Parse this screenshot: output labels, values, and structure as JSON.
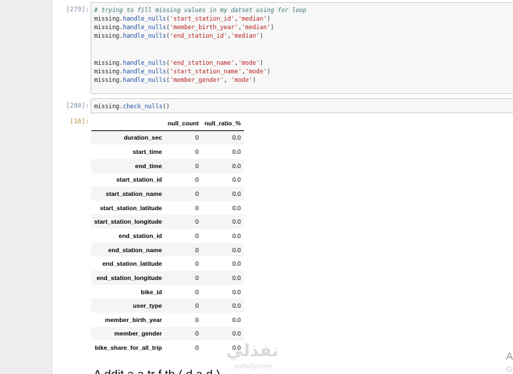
{
  "cells": {
    "loop_cell": {
      "prompt": "[279]:",
      "comment": "# trying to fill missing values in my datset using for loop",
      "lines": [
        {
          "obj": "missing",
          "fn": "handle_nulls",
          "arg1": "'start_station_id'",
          "arg2": "'median'"
        },
        {
          "obj": "missing",
          "fn": "handle_nulls",
          "arg1": "'member_birth_year'",
          "arg2": "'median'"
        },
        {
          "obj": "missing",
          "fn": "handle_nulls",
          "arg1": "'end_station_id'",
          "arg2": "'median'"
        },
        {
          "obj": "missing",
          "fn": "handle_nulls",
          "arg1": "'end_station_name'",
          "arg2": "'mode'"
        },
        {
          "obj": "missing",
          "fn": "handle_nulls",
          "arg1": "'start_station_name'",
          "arg2": "'mode'"
        },
        {
          "obj": "missing",
          "fn": "handle_nulls",
          "arg1": "'member_gender'",
          "arg2": " 'mode'"
        }
      ]
    },
    "check_cell": {
      "prompt": "[280]:",
      "obj": "missing",
      "fn": "check_nulls",
      "call_suffix": "()"
    },
    "output": {
      "prompt": "[16]:",
      "columns": [
        "null_count",
        "null_ratio_%"
      ],
      "rows": [
        {
          "index": "duration_sec",
          "null_count": "0",
          "null_ratio": "0.0"
        },
        {
          "index": "start_time",
          "null_count": "0",
          "null_ratio": "0.0"
        },
        {
          "index": "end_time",
          "null_count": "0",
          "null_ratio": "0.0"
        },
        {
          "index": "start_station_id",
          "null_count": "0",
          "null_ratio": "0.0"
        },
        {
          "index": "start_station_name",
          "null_count": "0",
          "null_ratio": "0.0"
        },
        {
          "index": "start_station_latitude",
          "null_count": "0",
          "null_ratio": "0.0"
        },
        {
          "index": "start_station_longitude",
          "null_count": "0",
          "null_ratio": "0.0"
        },
        {
          "index": "end_station_id",
          "null_count": "0",
          "null_ratio": "0.0"
        },
        {
          "index": "end_station_name",
          "null_count": "0",
          "null_ratio": "0.0"
        },
        {
          "index": "end_station_latitude",
          "null_count": "0",
          "null_ratio": "0.0"
        },
        {
          "index": "end_station_longitude",
          "null_count": "0",
          "null_ratio": "0.0"
        },
        {
          "index": "bike_id",
          "null_count": "0",
          "null_ratio": "0.0"
        },
        {
          "index": "user_type",
          "null_count": "0",
          "null_ratio": "0.0"
        },
        {
          "index": "member_birth_year",
          "null_count": "0",
          "null_ratio": "0.0"
        },
        {
          "index": "member_gender",
          "null_count": "0",
          "null_ratio": "0.0"
        },
        {
          "index": "bike_share_for_all_trip",
          "null_count": "0",
          "null_ratio": "0.0"
        }
      ]
    }
  },
  "watermark": {
    "text": "نفذلي",
    "sub": "nafezly.com"
  },
  "next_heading_fragment": "A ddit  a  a  tr  f  th  (  d  a  d  )",
  "edge_letters": {
    "a": "A",
    "b": "G"
  },
  "colors": {
    "cell_bg": "#f7f7f7",
    "prompt_in": "#7b8aa0",
    "prompt_out": "#b8893d",
    "string": "#ba2121",
    "function": "#1f4fa8",
    "comment": "#3b7a78"
  }
}
